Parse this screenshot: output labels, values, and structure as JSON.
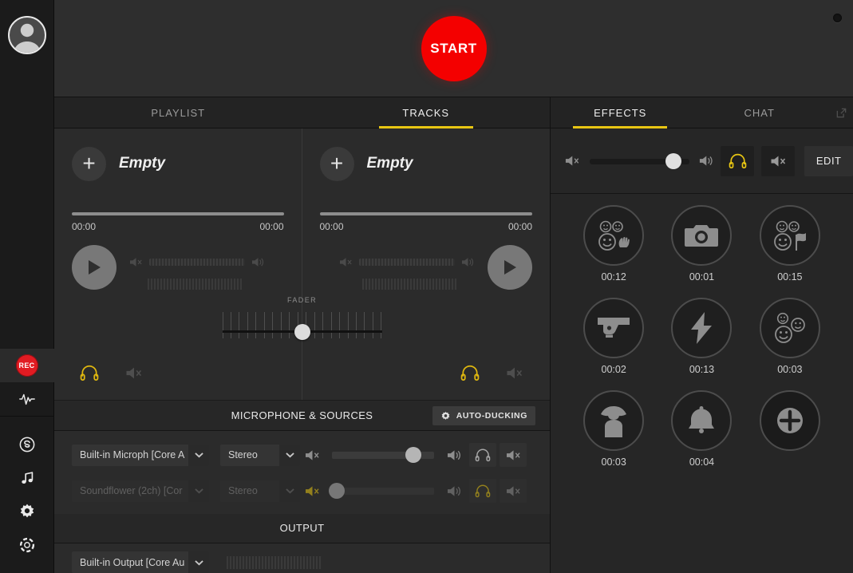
{
  "app": {
    "start_button": "START",
    "status_led": "status-led"
  },
  "sidebar": {
    "avatar": "user-avatar",
    "items": [
      {
        "id": "rec",
        "label": "REC",
        "icon": "record-icon",
        "active": true
      },
      {
        "id": "levels",
        "label": "",
        "icon": "waveform-icon",
        "active": false
      },
      {
        "id": "skype",
        "label": "",
        "icon": "skype-icon",
        "active": false
      },
      {
        "id": "music",
        "label": "",
        "icon": "music-note-icon",
        "active": false
      },
      {
        "id": "settings",
        "label": "",
        "icon": "gear-icon",
        "active": false
      },
      {
        "id": "support",
        "label": "",
        "icon": "lifebuoy-icon",
        "active": false
      }
    ]
  },
  "tabs_left": [
    {
      "label": "PLAYLIST",
      "active": false
    },
    {
      "label": "TRACKS",
      "active": true
    }
  ],
  "tabs_right": [
    {
      "label": "EFFECTS",
      "active": true
    },
    {
      "label": "CHAT",
      "active": false
    }
  ],
  "decks": [
    {
      "title": "Empty",
      "time_elapsed": "00:00",
      "time_total": "00:00",
      "add_label": "+",
      "progress_percent": 0,
      "volume_percent": 0
    },
    {
      "title": "Empty",
      "time_elapsed": "00:00",
      "time_total": "00:00",
      "add_label": "+",
      "progress_percent": 0,
      "volume_percent": 0
    }
  ],
  "fader": {
    "label": "FADER",
    "position_percent": 50
  },
  "microphone": {
    "section_title": "MICROPHONE & SOURCES",
    "auto_ducking_label": "AUTO-DUCKING",
    "rows": [
      {
        "device": "Built-in Microph [Core A",
        "channel": "Stereo",
        "volume_percent": 80,
        "muted": false,
        "headphone_active": false,
        "enabled": true
      },
      {
        "device": "Soundflower (2ch) [Cor",
        "channel": "Stereo",
        "volume_percent": 5,
        "muted": true,
        "headphone_active": true,
        "enabled": false
      }
    ]
  },
  "output": {
    "section_title": "OUTPUT",
    "device": "Built-in Output [Core Au"
  },
  "effects": {
    "toolbar": {
      "volume_percent": 84,
      "edit_label": "EDIT",
      "headphone_active": true
    },
    "items": [
      {
        "icon": "applause-icon",
        "time": "00:12"
      },
      {
        "icon": "camera-icon",
        "time": "00:01"
      },
      {
        "icon": "cheer-flag-icon",
        "time": "00:15"
      },
      {
        "icon": "gun-icon",
        "time": "00:02"
      },
      {
        "icon": "lightning-icon",
        "time": "00:13"
      },
      {
        "icon": "crowd-icon",
        "time": "00:03"
      },
      {
        "icon": "detective-icon",
        "time": "00:03"
      },
      {
        "icon": "bell-icon",
        "time": "00:04"
      },
      {
        "icon": "plus-icon",
        "time": ""
      }
    ]
  },
  "colors": {
    "accent_yellow": "#e8c613",
    "record_red": "#f40000",
    "panel_bg": "#2b2b2b",
    "sidebar_bg": "#1b1b1b"
  }
}
